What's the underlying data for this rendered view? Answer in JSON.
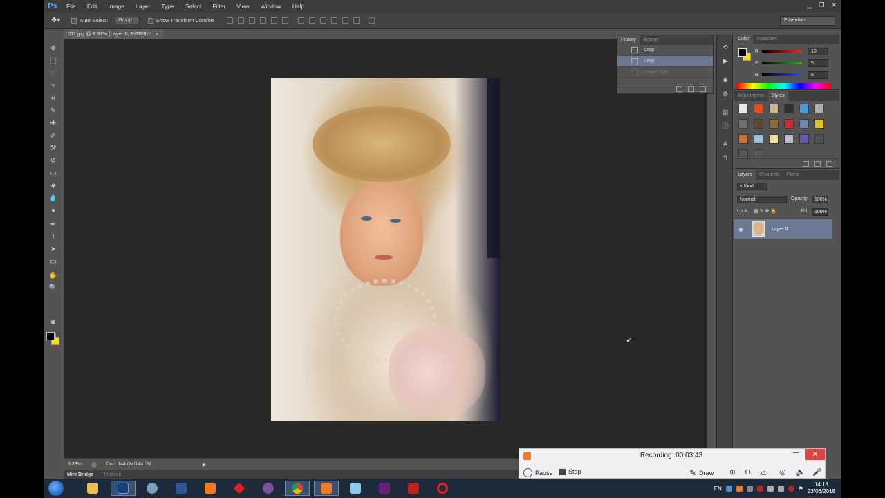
{
  "menubar": {
    "logo": "Ps",
    "items": [
      "File",
      "Edit",
      "Image",
      "Layer",
      "Type",
      "Select",
      "Filter",
      "View",
      "Window",
      "Help"
    ]
  },
  "optionsbar": {
    "auto_select_label": "Auto-Select:",
    "auto_select_value": "Group",
    "show_transform_label": "Show Transform Controls",
    "workspace": "Essentials"
  },
  "document": {
    "tab_title": "011.jpg @ 8.33% (Layer 0, RGB/8) *",
    "tab_close": "×",
    "zoom": "8.33%",
    "doc_size": "Doc: 144.0M/144.0M"
  },
  "bottom_tabs": [
    "Mini Bridge",
    "Timeline"
  ],
  "history": {
    "tabs": [
      "History",
      "Actions"
    ],
    "rows": [
      {
        "label": "Crop",
        "state": "normal"
      },
      {
        "label": "Crop",
        "state": "selected"
      },
      {
        "label": "Image Size",
        "state": "dimmed"
      }
    ]
  },
  "color_panel": {
    "tabs": [
      "Color",
      "Swatches"
    ],
    "channels": [
      {
        "name": "R",
        "value": "10",
        "color": "#e03030"
      },
      {
        "name": "G",
        "value": "5",
        "color": "#30b030"
      },
      {
        "name": "B",
        "value": "5",
        "color": "#3050e0"
      }
    ],
    "fg_color": "#0a0505",
    "bg_color": "#f5e11a"
  },
  "styles_panel": {
    "tabs": [
      "Adjustments",
      "Styles"
    ],
    "swatches": [
      "#e8e8e8",
      "#e84a1a",
      "#c8b890",
      "#303030",
      "#4a9ae0",
      "#b0b0b0",
      "#707070",
      "#5a4a2a",
      "#8a6a3a",
      "#c83030",
      "#6a8ab0",
      "#e0c020",
      "#d07030",
      "#a0c0e0",
      "#f0e0a0",
      "#c0c0d0",
      "#6a5ab0",
      "#505050",
      "#585858",
      "#585858"
    ]
  },
  "layers": {
    "tabs": [
      "Layers",
      "Channels",
      "Paths"
    ],
    "kind_label": "Kind",
    "blend_mode": "Normal",
    "opacity_label": "Opacity:",
    "opacity_value": "100%",
    "lock_label": "Lock:",
    "fill_label": "Fill:",
    "fill_value": "100%",
    "items": [
      {
        "name": "Layer 0",
        "visible": true
      }
    ]
  },
  "recorder": {
    "status": "Recording:  00:03:43",
    "pause_label": "Pause",
    "stop_label": "Stop",
    "draw_label": "Draw",
    "zoom_label": "x1"
  },
  "taskbar": {
    "language": "EN",
    "time": "14:18",
    "date": "23/06/2018"
  }
}
